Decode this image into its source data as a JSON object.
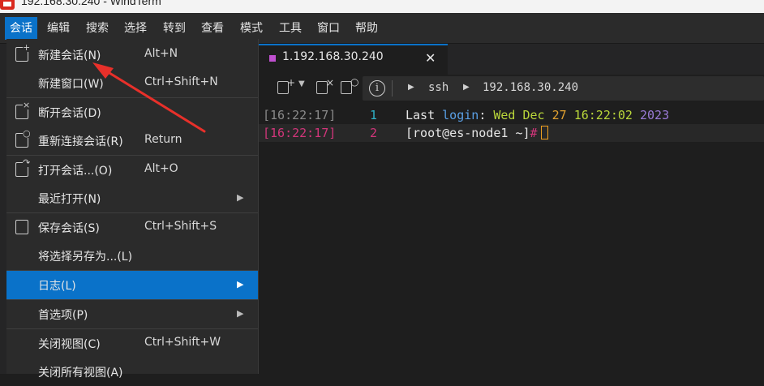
{
  "window": {
    "title": "192.168.30.240 - WindTerm"
  },
  "menubar": {
    "items": [
      "会话",
      "编辑",
      "搜索",
      "选择",
      "转到",
      "查看",
      "模式",
      "工具",
      "窗口",
      "帮助"
    ],
    "active": "会话"
  },
  "session_menu": {
    "items": [
      {
        "label": "新建会话(N)",
        "shortcut": "Alt+N",
        "icon": "new-session-icon"
      },
      {
        "label": "新建窗口(W)",
        "shortcut": "Ctrl+Shift+N"
      },
      {
        "label": "断开会话(D)",
        "shortcut": "",
        "icon": "disconnect-icon"
      },
      {
        "label": "重新连接会话(R)",
        "shortcut": "Return",
        "icon": "reconnect-icon"
      },
      {
        "label": "打开会话...(O)",
        "shortcut": "Alt+O",
        "icon": "open-session-icon"
      },
      {
        "label": "最近打开(N)",
        "shortcut": "",
        "submenu": true
      },
      {
        "label": "保存会话(S)",
        "shortcut": "Ctrl+Shift+S",
        "icon": "save-icon"
      },
      {
        "label": "将选择另存为...(L)",
        "shortcut": ""
      },
      {
        "label": "日志(L)",
        "shortcut": "",
        "submenu": true,
        "highlighted": true
      },
      {
        "label": "首选项(P)",
        "shortcut": "",
        "submenu": true
      },
      {
        "label": "关闭视图(C)",
        "shortcut": "Ctrl+Shift+W"
      },
      {
        "label": "关闭所有视图(A)",
        "shortcut": ""
      }
    ]
  },
  "tab": {
    "title": "1.192.168.30.240",
    "close": "✕"
  },
  "breadcrumb": {
    "protocol": "ssh",
    "host": "192.168.30.240"
  },
  "terminal": {
    "lines": [
      {
        "time": "[16:22:17]",
        "number": "1",
        "parts": [
          "Last ",
          "login",
          ": ",
          "Wed Dec ",
          "27 ",
          "16:22:02 ",
          "2023"
        ]
      },
      {
        "time": "[16:22:17]",
        "number": "2",
        "prompt": "[root@es-node1 ~]",
        "hash": "#"
      }
    ]
  },
  "colors": {
    "accent": "#0a72c9",
    "annotation_arrow": "#e8302a",
    "timestamp_current": "#d1357a",
    "number": "#2fb3c9"
  }
}
